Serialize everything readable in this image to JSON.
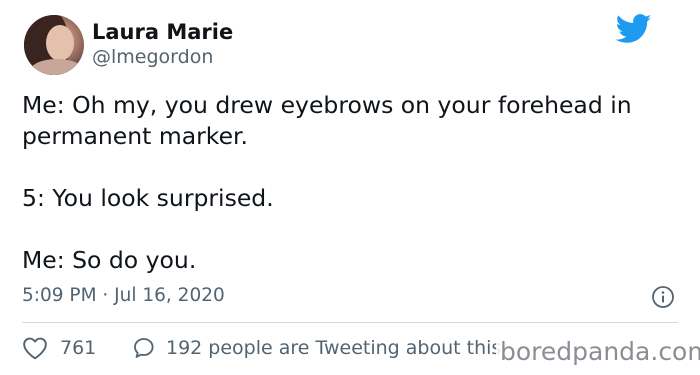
{
  "author": {
    "name": "Laura Marie",
    "handle": "@lmegordon"
  },
  "tweet": {
    "lines": [
      "Me: Oh my, you drew eyebrows on your forehead in permanent marker.",
      "",
      "5: You look surprised.",
      "",
      "Me: So do you."
    ],
    "timestamp": "5:09 PM · Jul 16, 2020"
  },
  "engagement": {
    "likes": "761",
    "conversation": "192 people are Tweeting about this"
  },
  "watermark": "boredpanda.com",
  "colors": {
    "twitter_blue": "#1d9bf0",
    "secondary_text": "#536471",
    "divider": "#cfd9de"
  },
  "icons": {
    "logo": "twitter-bird-icon",
    "info": "info-icon",
    "like": "heart-icon",
    "reply": "speech-bubble-icon"
  }
}
